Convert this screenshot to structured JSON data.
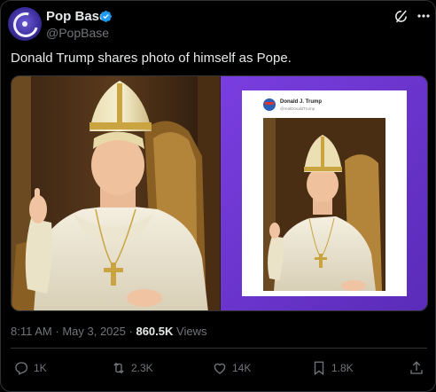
{
  "author": {
    "name": "Pop Base",
    "handle": "@PopBase",
    "verified": true,
    "avatar_icon": "popbase-logo-icon"
  },
  "tweet": {
    "text": "Donald Trump shares photo of himself as Pope."
  },
  "embedded_post": {
    "name": "Donald J. Trump",
    "handle": "@realDonaldTrump"
  },
  "meta": {
    "time": "8:11 AM",
    "separator": "·",
    "date": "May 3, 2025",
    "views_count": "860.5K",
    "views_label": "Views"
  },
  "actions": {
    "replies": "1K",
    "reposts": "2.3K",
    "likes": "14K",
    "bookmarks": "1.8K"
  },
  "colors": {
    "background": "#000000",
    "text": "#e7e9ea",
    "muted": "#71767b",
    "verified_blue": "#1d9bf0",
    "purple_bg": "#6f3fd4"
  }
}
